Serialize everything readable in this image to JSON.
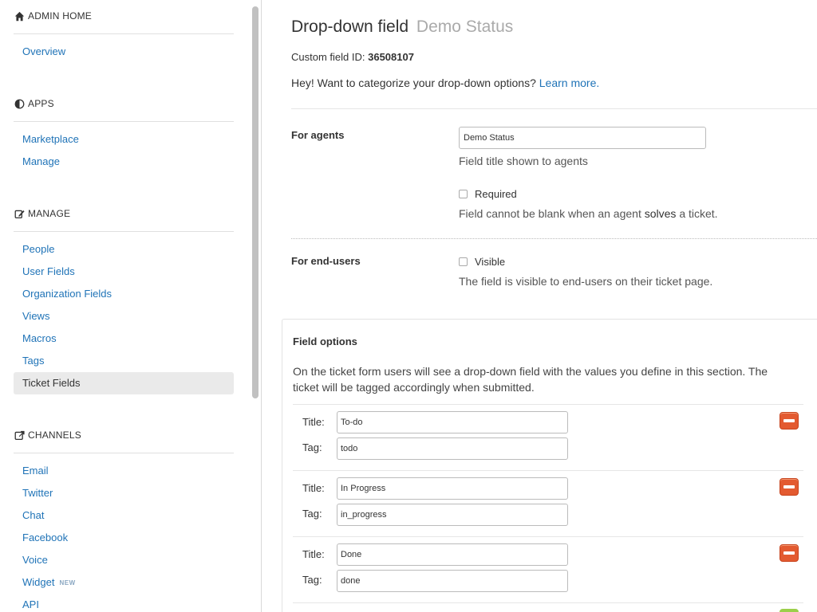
{
  "sidebar": {
    "sections": [
      {
        "title": "ADMIN HOME",
        "icon": "home-icon",
        "items": [
          {
            "label": "Overview"
          }
        ]
      },
      {
        "title": "APPS",
        "icon": "half-circle-icon",
        "items": [
          {
            "label": "Marketplace"
          },
          {
            "label": "Manage"
          }
        ]
      },
      {
        "title": "MANAGE",
        "icon": "edit-icon",
        "items": [
          {
            "label": "People"
          },
          {
            "label": "User Fields"
          },
          {
            "label": "Organization Fields"
          },
          {
            "label": "Views"
          },
          {
            "label": "Macros"
          },
          {
            "label": "Tags"
          },
          {
            "label": "Ticket Fields",
            "active": true
          }
        ]
      },
      {
        "title": "CHANNELS",
        "icon": "share-icon",
        "items": [
          {
            "label": "Email"
          },
          {
            "label": "Twitter"
          },
          {
            "label": "Chat"
          },
          {
            "label": "Facebook"
          },
          {
            "label": "Voice"
          },
          {
            "label": "Widget",
            "badge": "NEW"
          },
          {
            "label": "API"
          }
        ]
      }
    ]
  },
  "main": {
    "title": "Drop-down field",
    "title_sub": "Demo Status",
    "custom_field_id_label": "Custom field ID:",
    "custom_field_id": "36508107",
    "hey_text": "Hey! Want to categorize your drop-down options?",
    "learn_more": "Learn more.",
    "for_agents": {
      "label": "For agents",
      "title_value": "Demo Status",
      "help": "Field title shown to agents",
      "required_label": "Required",
      "required_help_pre": "Field cannot be blank when an agent",
      "required_help_bold": "solves",
      "required_help_post": "a ticket."
    },
    "for_end_users": {
      "label": "For end-users",
      "visible_label": "Visible",
      "visible_help": "The field is visible to end-users on their ticket page."
    },
    "field_options": {
      "title": "Field options",
      "description": "On the ticket form users will see a drop-down field with the values you define in this section. The ticket will be tagged accordingly when submitted.",
      "title_label": "Title:",
      "tag_label": "Tag:",
      "options": [
        {
          "title": "To-do",
          "tag": "todo"
        },
        {
          "title": "In Progress",
          "tag": "in_progress"
        },
        {
          "title": "Done",
          "tag": "done"
        }
      ]
    }
  },
  "colors": {
    "link": "#1f73b7",
    "remove": "#e35a30",
    "add": "#9bcf4a",
    "active_bg": "#eaeaea"
  }
}
